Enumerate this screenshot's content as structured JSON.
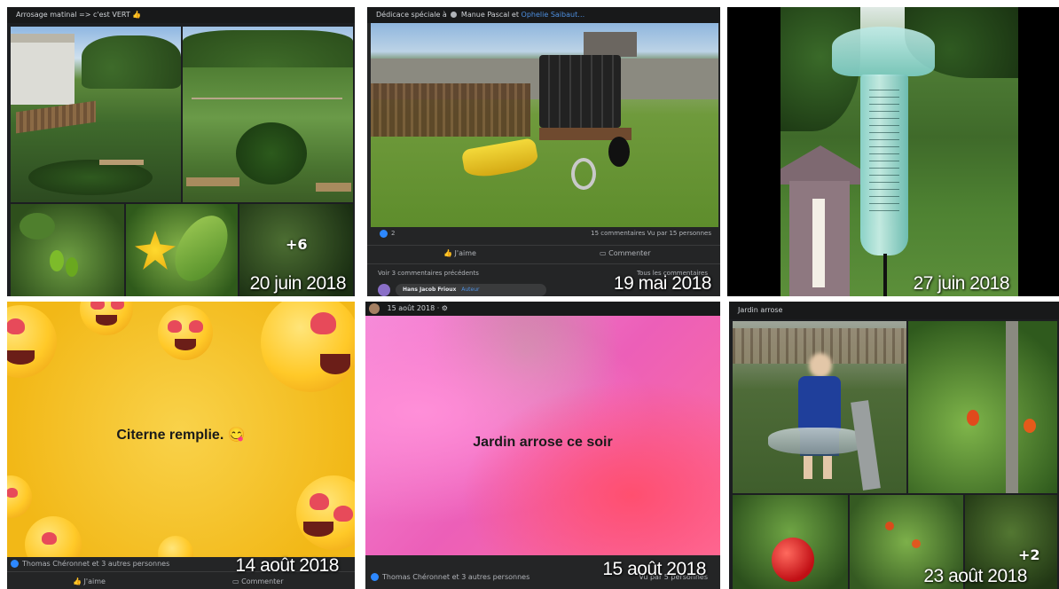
{
  "tiles": {
    "t1": {
      "header": "Arrosage matinal => c'est VERT 👍",
      "more_count": "+6",
      "date": "20 juin 2018"
    },
    "t2": {
      "header_prefix": "Dédicace spéciale à",
      "header_name1": "Manue Pascal et",
      "header_name2": "Ophelie Saibaut…",
      "reactions_count": "2",
      "comments_stats": "15 commentaires  Vu par 15 personnes",
      "like_label": "J'aime",
      "comment_label": "Commenter",
      "previous_comments": "Voir 3 commentaires précédents",
      "all_comments": "Tous les commentaires",
      "commenter_name": "Hans Jacob Frioux",
      "commenter_tag": "Auteur",
      "date": "19 mai 2018"
    },
    "t3": {
      "date": "27 juin 2018"
    },
    "t4": {
      "message": "Citerne remplie. 😋",
      "reactions": "Thomas Chéronnet et 3 autres personnes",
      "like_label": "J'aime",
      "comment_label": "Commenter",
      "date": "14 août 2018"
    },
    "t5": {
      "header": "15 août 2018 · ⚙",
      "message": "Jardin arrose ce soir",
      "reactions": "Thomas Chéronnet et 3 autres personnes",
      "views": "Vu par 5 personnes",
      "date": "15 août 2018"
    },
    "t6": {
      "header": "Jardin arrose",
      "more_count": "+2",
      "date": "23 août 2018"
    }
  },
  "colors": {
    "fb_dark": "#18191a",
    "fb_blue": "#2d88ff",
    "yellow_bg": "#f7c325",
    "pink_bg": "#f06fc6"
  }
}
